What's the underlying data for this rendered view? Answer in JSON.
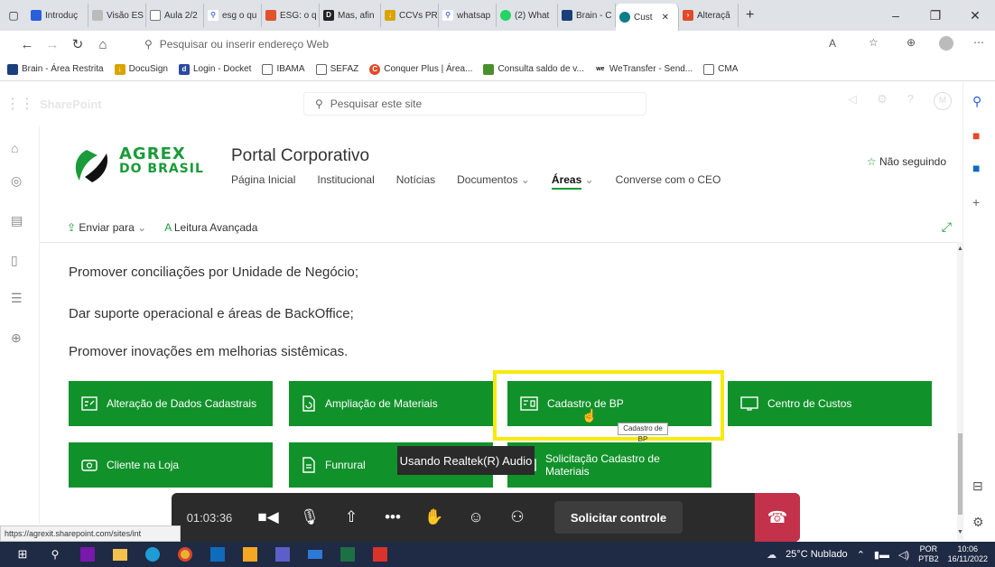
{
  "browser": {
    "tabs": [
      {
        "label": "Introduç",
        "color": "#2b5fd9"
      },
      {
        "label": "Visão ES",
        "color": "#999999"
      },
      {
        "label": "Aula 2/2",
        "color": "#777777"
      },
      {
        "label": "esg o qu",
        "color": "#4a6fd6"
      },
      {
        "label": "ESG: o q",
        "color": "#e0532b"
      },
      {
        "label": "Mas, afin",
        "color": "#222222"
      },
      {
        "label": "CCVs PR",
        "color": "#d9a400"
      },
      {
        "label": "whatsap",
        "color": "#4a6fd6"
      },
      {
        "label": "(2) What",
        "color": "#25d366"
      },
      {
        "label": "Brain - C",
        "color": "#1b3f7a"
      },
      {
        "label": "Cust",
        "color": "#0f7c8a"
      },
      {
        "label": "Alteraçã",
        "color": "#e04b2b"
      }
    ],
    "new_tab": "+",
    "address_placeholder": "Pesquisar ou inserir endereço Web",
    "bookmarks": [
      "Brain - Área Restrita",
      "DocuSign",
      "Login - Docket",
      "IBAMA",
      "SEFAZ",
      "Conquer Plus | Área...",
      "Consulta saldo de v...",
      "WeTransfer - Send...",
      "CMA"
    ]
  },
  "sharepoint": {
    "brand": "SharePoint",
    "search_placeholder": "Pesquisar este site",
    "avatar": "M"
  },
  "site": {
    "logo_line1": "AGREX",
    "logo_line2": "DO BRASIL",
    "title": "Portal Corporativo",
    "nav": [
      "Página Inicial",
      "Institucional",
      "Notícias",
      "Documentos",
      "Áreas",
      "Converse com o CEO"
    ],
    "follow": "Não seguindo",
    "send_to": "Enviar para",
    "reader": "Leitura Avançada"
  },
  "content": {
    "paragraphs": [
      "Promover conciliações por Unidade de Negócio;",
      "Dar suporte operacional e áreas de BackOffice;",
      "Promover inovações em melhorias sistêmicas."
    ],
    "tiles": [
      "Alteração de Dados Cadastrais",
      "Ampliação de Materiais",
      "Cadastro de BP",
      "Centro de Custos",
      "Cliente na Loja",
      "Funrural",
      "Solicitação Cadastro de Materiais"
    ],
    "tooltip": "Cadastro de BP",
    "accent_color": "#11912a",
    "highlight_color": "#f7ea0d"
  },
  "teams_call": {
    "audio_tip": "Usando Realtek(R) Audio",
    "timer": "01:03:36",
    "request_control": "Solicitar controle"
  },
  "status_url": "https://agrexit.sharepoint.com/sites/int",
  "taskbar": {
    "weather": "25°C Nublado",
    "lang": "POR",
    "lang2": "PTB2",
    "time": "10:06",
    "date": "16/11/2022"
  }
}
